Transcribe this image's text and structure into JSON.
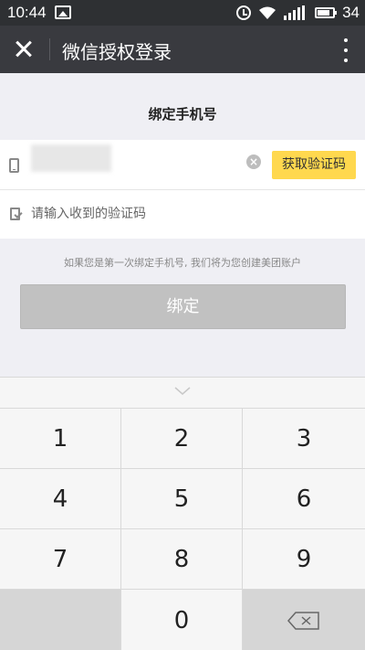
{
  "status_bar": {
    "time": "10:44",
    "battery": "34"
  },
  "nav": {
    "title": "微信授权登录"
  },
  "page": {
    "title": "绑定手机号"
  },
  "form": {
    "get_code_label": "获取验证码",
    "code_placeholder": "请输入收到的验证码",
    "clear_label": "×"
  },
  "hint": "如果您是第一次绑定手机号, 我们将为您创建美团账户",
  "bind_button": "绑定",
  "keypad": {
    "keys": [
      "1",
      "2",
      "3",
      "4",
      "5",
      "6",
      "7",
      "8",
      "9",
      "0"
    ]
  },
  "colors": {
    "accent": "#ffd84e",
    "nav_bg": "#393a3f",
    "status_bg": "#2e3033"
  }
}
